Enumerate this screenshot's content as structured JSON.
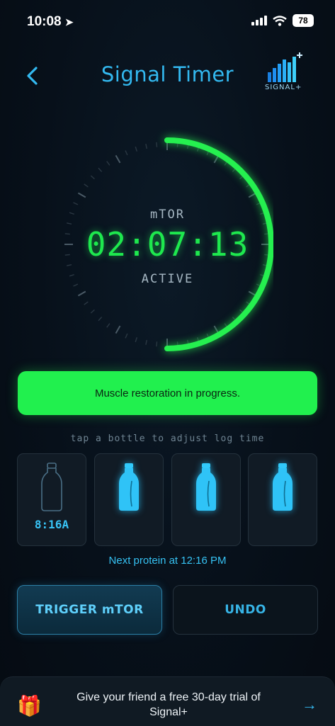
{
  "status_bar": {
    "time": "10:08",
    "battery": "78"
  },
  "header": {
    "title": "Signal Timer",
    "logo_text": "SIGNAL+"
  },
  "timer": {
    "label": "mTOR",
    "value": "02:07:13",
    "state": "ACTIVE",
    "progress": 0.5
  },
  "banner": {
    "text": "Muscle restoration in progress."
  },
  "hint": "tap a bottle to adjust log time",
  "bottles": [
    {
      "time": "8:16A",
      "filled": false
    },
    {
      "time": "",
      "filled": true
    },
    {
      "time": "",
      "filled": true
    },
    {
      "time": "",
      "filled": true
    }
  ],
  "next_protein": "Next protein at 12:16 PM",
  "buttons": {
    "trigger": "TRIGGER mTOR",
    "undo": "UNDO"
  },
  "referral": {
    "line1": "Give your friend a free 30-day trial of",
    "line2": "Signal+",
    "gift_icon": "gift-icon",
    "arrow_icon": "arrow-right-icon"
  },
  "colors": {
    "accent_green": "#21f04e",
    "accent_blue": "#33b9f0",
    "background": "#07101a"
  }
}
